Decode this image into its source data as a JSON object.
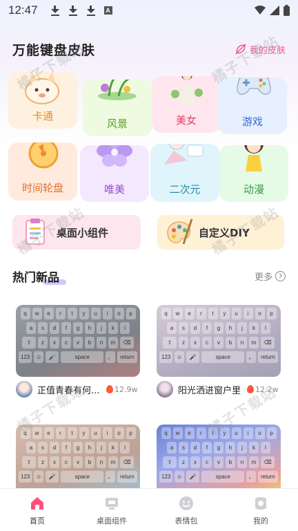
{
  "status_bar": {
    "time": "12:47",
    "notif_letter": "A"
  },
  "header": {
    "title": "万能键盘皮肤",
    "my_skin_label": "我的皮肤"
  },
  "categories": [
    {
      "label": "卡通",
      "bg": "#fff1e0",
      "color": "#e0902a",
      "icon": "cartoon-cat-icon"
    },
    {
      "label": "风景",
      "bg": "#eefbe0",
      "color": "#5a9a2a",
      "icon": "scenery-icon"
    },
    {
      "label": "美女",
      "bg": "#ffe6ee",
      "color": "#e0406a",
      "icon": "beauty-girl-icon"
    },
    {
      "label": "游戏",
      "bg": "#e6f0ff",
      "color": "#3a6ad0",
      "icon": "gamepad-icon"
    },
    {
      "label": "时间轮盘",
      "bg": "#ffeadd",
      "color": "#e0702a",
      "icon": "time-wheel-icon"
    },
    {
      "label": "唯美",
      "bg": "#f4e8ff",
      "color": "#9a4ad0",
      "icon": "flower-icon"
    },
    {
      "label": "二次元",
      "bg": "#e0f4fb",
      "color": "#2a8aaa",
      "icon": "anime-girl-icon"
    },
    {
      "label": "动漫",
      "bg": "#e6fbe6",
      "color": "#3a9a4a",
      "icon": "cartoon-doll-icon"
    }
  ],
  "widgets": [
    {
      "label": "桌面小组件",
      "bg": "#fde6ee",
      "icon": "clipboard-icon"
    },
    {
      "label": "自定义DIY",
      "bg": "#fff1d6",
      "icon": "palette-icon"
    }
  ],
  "hot_section": {
    "title": "热门新品",
    "more_label": "更多"
  },
  "keyboard_rows": [
    [
      "q",
      "w",
      "e",
      "r",
      "t",
      "y",
      "u",
      "i",
      "o",
      "p"
    ],
    [
      "a",
      "s",
      "d",
      "f",
      "g",
      "h",
      "j",
      "k",
      "l"
    ],
    [
      "⇧",
      "z",
      "x",
      "c",
      "v",
      "b",
      "n",
      "m",
      "⌫"
    ],
    [
      "123",
      "☺",
      "🎤",
      "space",
      "，",
      "return"
    ]
  ],
  "items": [
    {
      "name": "正值青春有何...",
      "count": "12.9w",
      "bg": "#8a8e94"
    },
    {
      "name": "阳光洒进窗户里",
      "count": "12.2w",
      "bg": "#bdb6c6"
    },
    {
      "name": "",
      "count": "",
      "bg": "#c9b2a4"
    },
    {
      "name": "",
      "count": "",
      "bg": "#8a9ad6"
    }
  ],
  "watermark_text": "橘子下载站",
  "bottom_nav": [
    {
      "label": "首页",
      "icon": "home-icon",
      "active": true
    },
    {
      "label": "桌面组件",
      "icon": "desktop-widget-icon",
      "active": false
    },
    {
      "label": "表情包",
      "icon": "emoji-icon",
      "active": false
    },
    {
      "label": "我的",
      "icon": "profile-icon",
      "active": false
    }
  ],
  "colors": {
    "accent": "#f05a8a",
    "brand_pink": "#ff4f7b"
  }
}
